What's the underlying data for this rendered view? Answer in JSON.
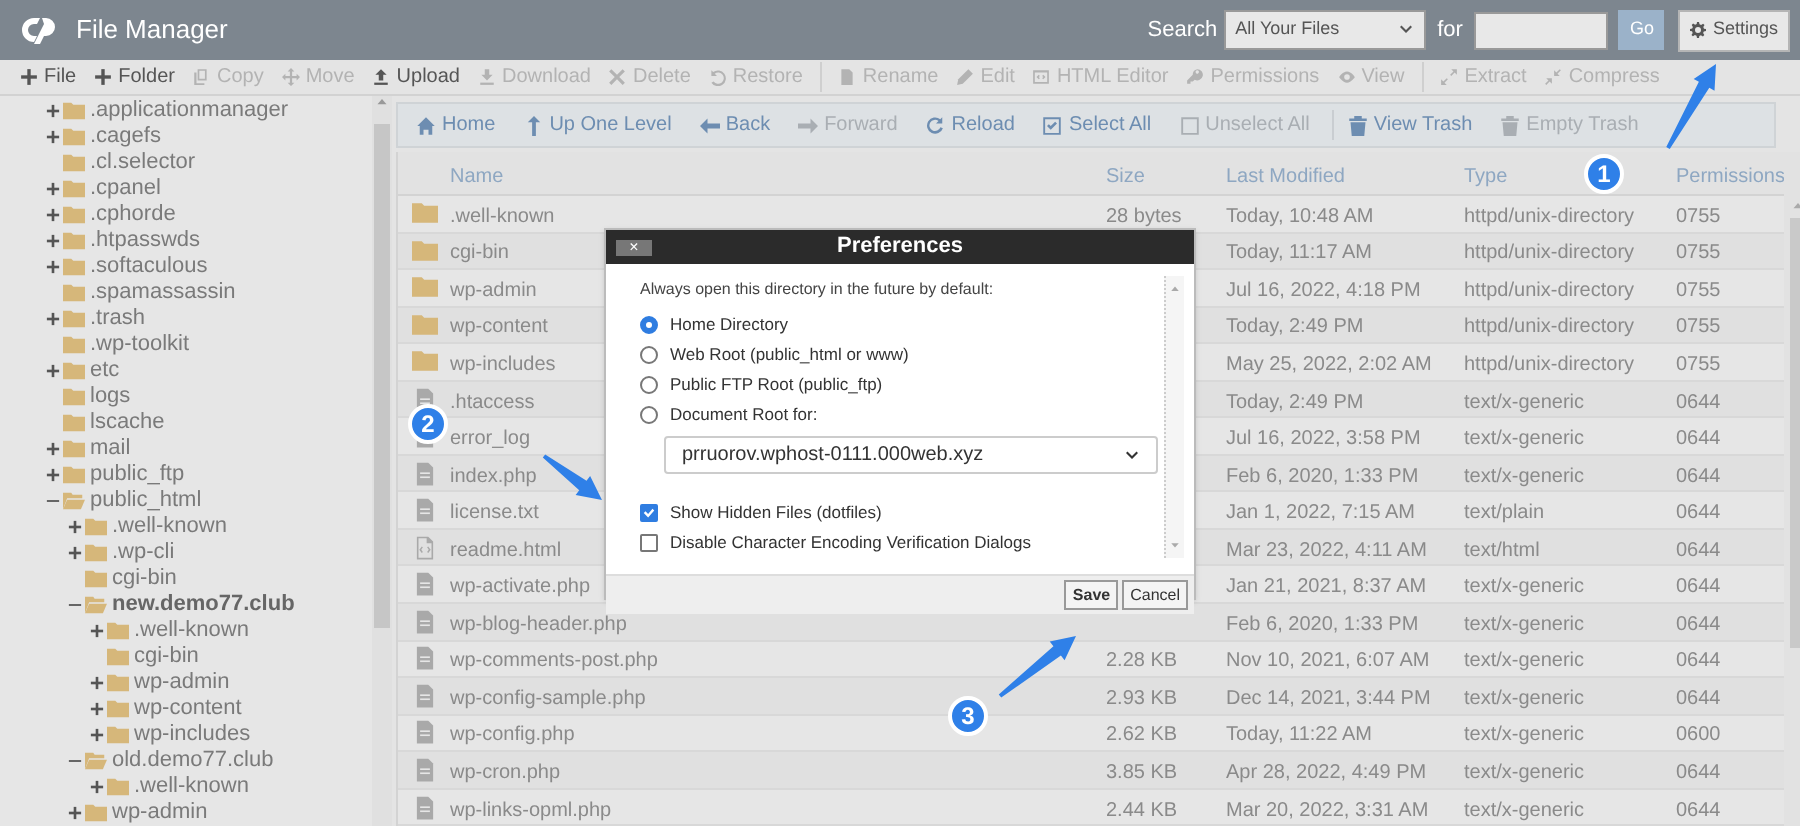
{
  "header": {
    "title": "File Manager",
    "search_label": "Search",
    "scope": "All Your Files",
    "for_label": "for",
    "go": "Go",
    "settings": "Settings"
  },
  "toolbar": [
    {
      "kind": "button",
      "label": "File",
      "disabled": false
    },
    {
      "kind": "button",
      "label": "Folder",
      "disabled": false
    },
    {
      "kind": "button",
      "label": "Copy",
      "disabled": true
    },
    {
      "kind": "button",
      "label": "Move",
      "disabled": true
    },
    {
      "kind": "button",
      "label": "Upload",
      "disabled": false
    },
    {
      "kind": "button",
      "label": "Download",
      "disabled": true
    },
    {
      "kind": "button",
      "label": "Delete",
      "disabled": true
    },
    {
      "kind": "button",
      "label": "Restore",
      "disabled": true
    },
    {
      "kind": "separator"
    },
    {
      "kind": "button",
      "label": "Rename",
      "disabled": true
    },
    {
      "kind": "button",
      "label": "Edit",
      "disabled": true
    },
    {
      "kind": "button",
      "label": "HTML Editor",
      "disabled": true
    },
    {
      "kind": "button",
      "label": "Permissions",
      "disabled": true
    },
    {
      "kind": "button",
      "label": "View",
      "disabled": true
    },
    {
      "kind": "separator"
    },
    {
      "kind": "button",
      "label": "Extract",
      "disabled": true
    },
    {
      "kind": "button",
      "label": "Compress",
      "disabled": true
    }
  ],
  "tree": [
    {
      "label": ".applicationmanager",
      "expandable": true,
      "expanded": false,
      "selected": false
    },
    {
      "label": ".cagefs",
      "expandable": true,
      "expanded": false,
      "selected": false
    },
    {
      "label": ".cl.selector",
      "expandable": false,
      "expanded": false,
      "selected": false
    },
    {
      "label": ".cpanel",
      "expandable": true,
      "expanded": false,
      "selected": false
    },
    {
      "label": ".cphorde",
      "expandable": true,
      "expanded": false,
      "selected": false
    },
    {
      "label": ".htpasswds",
      "expandable": true,
      "expanded": false,
      "selected": false
    },
    {
      "label": ".softaculous",
      "expandable": true,
      "expanded": false,
      "selected": false
    },
    {
      "label": ".spamassassin",
      "expandable": false,
      "expanded": false,
      "selected": false
    },
    {
      "label": ".trash",
      "expandable": true,
      "expanded": false,
      "selected": false
    },
    {
      "label": ".wp-toolkit",
      "expandable": false,
      "expanded": false,
      "selected": false
    },
    {
      "label": "etc",
      "expandable": true,
      "expanded": false,
      "selected": false
    },
    {
      "label": "logs",
      "expandable": false,
      "expanded": false,
      "selected": false
    },
    {
      "label": "lscache",
      "expandable": false,
      "expanded": false,
      "selected": false
    },
    {
      "label": "mail",
      "expandable": true,
      "expanded": false,
      "selected": false
    },
    {
      "label": "public_ftp",
      "expandable": true,
      "expanded": false,
      "selected": false
    },
    {
      "label": "public_html",
      "expandable": true,
      "expanded": true,
      "selected": false,
      "children": [
        {
          "label": ".well-known",
          "expandable": true,
          "expanded": false,
          "selected": false
        },
        {
          "label": ".wp-cli",
          "expandable": true,
          "expanded": false,
          "selected": false
        },
        {
          "label": "cgi-bin",
          "expandable": false,
          "expanded": false,
          "selected": false
        },
        {
          "label": "new.demo77.club",
          "expandable": true,
          "expanded": true,
          "selected": true,
          "children": [
            {
              "label": ".well-known",
              "expandable": true,
              "expanded": false,
              "selected": false
            },
            {
              "label": "cgi-bin",
              "expandable": false,
              "expanded": false,
              "selected": false
            },
            {
              "label": "wp-admin",
              "expandable": true,
              "expanded": false,
              "selected": false
            },
            {
              "label": "wp-content",
              "expandable": true,
              "expanded": false,
              "selected": false
            },
            {
              "label": "wp-includes",
              "expandable": true,
              "expanded": false,
              "selected": false
            }
          ]
        },
        {
          "label": "old.demo77.club",
          "expandable": true,
          "expanded": true,
          "selected": false,
          "children": [
            {
              "label": ".well-known",
              "expandable": true,
              "expanded": false,
              "selected": false
            }
          ]
        },
        {
          "label": "wp-admin",
          "expandable": true,
          "expanded": false,
          "selected": false
        }
      ]
    }
  ],
  "nav": [
    {
      "label": "Home",
      "disabled": false
    },
    {
      "label": "Up One Level",
      "disabled": false
    },
    {
      "label": "Back",
      "disabled": false
    },
    {
      "label": "Forward",
      "disabled": true
    },
    {
      "label": "Reload",
      "disabled": false
    },
    {
      "label": "Select All",
      "disabled": false
    },
    {
      "label": "Unselect All",
      "disabled": true
    },
    {
      "label": "View Trash",
      "disabled": false
    },
    {
      "label": "Empty Trash",
      "disabled": true
    }
  ],
  "table": {
    "columns": [
      "Name",
      "Size",
      "Last Modified",
      "Type",
      "Permissions"
    ],
    "rows": [
      {
        "kind": "folder",
        "name": ".well-known",
        "size": "28 bytes",
        "modified": "Today, 10:48 AM",
        "type": "httpd/unix-directory",
        "permissions": "0755"
      },
      {
        "kind": "folder",
        "name": "cgi-bin",
        "modified": "Today, 11:17 AM",
        "type": "httpd/unix-directory",
        "permissions": "0755"
      },
      {
        "kind": "folder",
        "name": "wp-admin",
        "modified": "Jul 16, 2022, 4:18 PM",
        "type": "httpd/unix-directory",
        "permissions": "0755"
      },
      {
        "kind": "folder",
        "name": "wp-content",
        "modified": "Today, 2:49 PM",
        "type": "httpd/unix-directory",
        "permissions": "0755"
      },
      {
        "kind": "folder",
        "name": "wp-includes",
        "modified": "May 25, 2022, 2:02 AM",
        "type": "httpd/unix-directory",
        "permissions": "0755"
      },
      {
        "kind": "file",
        "name": ".htaccess",
        "modified": "Today, 2:49 PM",
        "type": "text/x-generic",
        "permissions": "0644"
      },
      {
        "kind": "file",
        "name": "error_log",
        "modified": "Jul 16, 2022, 3:58 PM",
        "type": "text/x-generic",
        "permissions": "0644"
      },
      {
        "kind": "file",
        "name": "index.php",
        "modified": "Feb 6, 2020, 1:33 PM",
        "type": "text/x-generic",
        "permissions": "0644"
      },
      {
        "kind": "file",
        "name": "license.txt",
        "modified": "Jan 1, 2022, 7:15 AM",
        "type": "text/plain",
        "permissions": "0644"
      },
      {
        "kind": "html",
        "name": "readme.html",
        "modified": "Mar 23, 2022, 4:11 AM",
        "type": "text/html",
        "permissions": "0644"
      },
      {
        "kind": "file",
        "name": "wp-activate.php",
        "modified": "Jan 21, 2021, 8:37 AM",
        "type": "text/x-generic",
        "permissions": "0644"
      },
      {
        "kind": "file",
        "name": "wp-blog-header.php",
        "modified": "Feb 6, 2020, 1:33 PM",
        "type": "text/x-generic",
        "permissions": "0644"
      },
      {
        "kind": "file",
        "name": "wp-comments-post.php",
        "size": "2.28 KB",
        "modified": "Nov 10, 2021, 6:07 AM",
        "type": "text/x-generic",
        "permissions": "0644"
      },
      {
        "kind": "file",
        "name": "wp-config-sample.php",
        "size": "2.93 KB",
        "modified": "Dec 14, 2021, 3:44 PM",
        "type": "text/x-generic",
        "permissions": "0644"
      },
      {
        "kind": "file",
        "name": "wp-config.php",
        "size": "2.62 KB",
        "modified": "Today, 11:22 AM",
        "type": "text/x-generic",
        "permissions": "0600"
      },
      {
        "kind": "file",
        "name": "wp-cron.php",
        "size": "3.85 KB",
        "modified": "Apr 28, 2022, 4:49 PM",
        "type": "text/x-generic",
        "permissions": "0644"
      },
      {
        "kind": "file",
        "name": "wp-links-opml.php",
        "size": "2.44 KB",
        "modified": "Mar 20, 2022, 3:31 AM",
        "type": "text/x-generic",
        "permissions": "0644"
      }
    ]
  },
  "dialog": {
    "title": "Preferences",
    "close": "×",
    "intro": "Always open this directory in the future by default:",
    "radios": [
      {
        "label": "Home Directory",
        "selected": true
      },
      {
        "label": "Web Root (public_html or www)",
        "selected": false
      },
      {
        "label": "Public FTP Root (public_ftp)",
        "selected": false
      },
      {
        "label": "Document Root for:",
        "selected": false
      }
    ],
    "domain": "prruorov.wphost-0111.000web.xyz",
    "checkboxes": [
      {
        "label": "Show Hidden Files (dotfiles)",
        "checked": true
      },
      {
        "label": "Disable Character Encoding Verification Dialogs",
        "checked": false
      }
    ],
    "buttons": [
      "Save",
      "Cancel"
    ]
  },
  "annotations": [
    {
      "label": "1"
    },
    {
      "label": "2"
    },
    {
      "label": "3"
    }
  ]
}
